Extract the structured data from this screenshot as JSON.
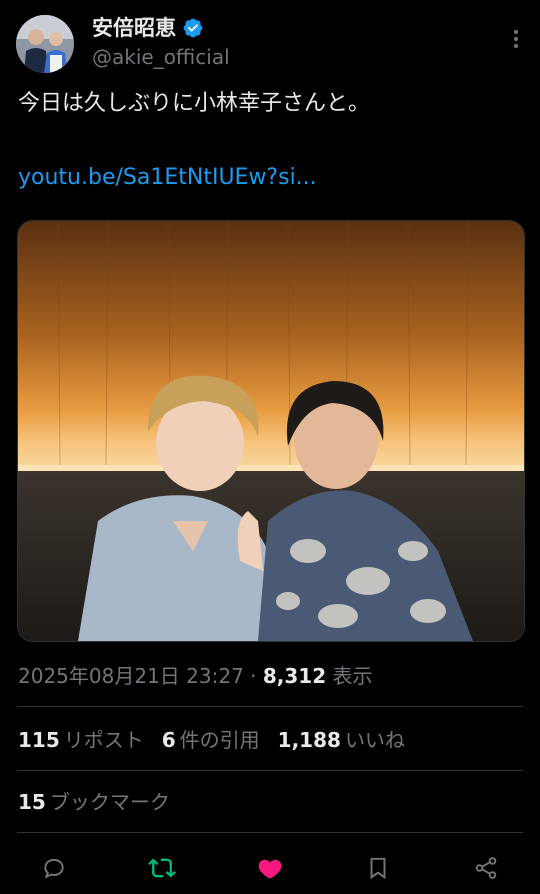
{
  "author": {
    "display_name": "安倍昭恵",
    "handle": "@akie_official",
    "verified_icon": "verified-badge-icon",
    "verified_color": "#1d9bf0"
  },
  "tweet": {
    "text": "今日は久しぶりに小林幸子さんと。",
    "link": "youtu.be/Sa1EtNtIUEw?si..."
  },
  "meta": {
    "date": "2025年08月21日 23:27",
    "separator": " · ",
    "views": "8,312",
    "views_label": "表示"
  },
  "stats": {
    "reposts": "115",
    "reposts_label": "リポスト",
    "quotes": "6",
    "quotes_label": "件の引用",
    "likes": "1,188",
    "likes_label": "いいね",
    "bookmarks": "15",
    "bookmarks_label": "ブックマーク"
  },
  "actions": {
    "reply_icon": "reply-icon",
    "repost_icon": "repost-icon",
    "like_icon": "heart-icon",
    "bookmark_icon": "bookmark-icon",
    "share_icon": "share-icon",
    "repost_color": "#00ba7c",
    "like_color": "#f91880"
  },
  "colors": {
    "background": "#000000",
    "text": "#e7e9ea",
    "secondary": "#71767b",
    "link": "#1d9bf0",
    "divider": "#2f3336"
  }
}
